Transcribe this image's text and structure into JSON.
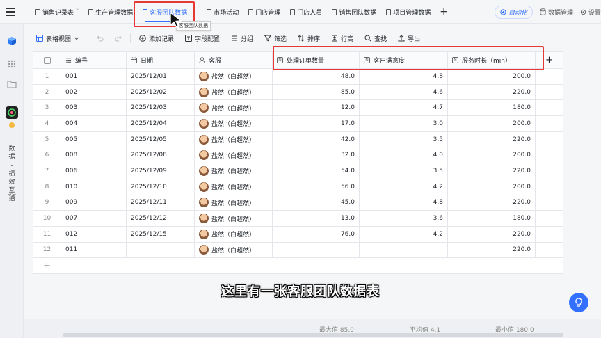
{
  "tabs": [
    {
      "label": "销售记录表",
      "suffix": "\""
    },
    {
      "label": "生产管理数据"
    },
    {
      "label": "客服团队数据",
      "active": true
    },
    {
      "label": "市场活动"
    },
    {
      "label": "门店管理"
    },
    {
      "label": "门店人员"
    },
    {
      "label": "销售团队数据"
    },
    {
      "label": "项目管理数据"
    }
  ],
  "tab_tooltip": "客服团队数据",
  "top_right": {
    "automation": "自动化",
    "data_manage": "数据管理",
    "settings": "设置"
  },
  "sidebar": {
    "workspace_label": [
      "数",
      "据",
      "-",
      "绩",
      "效",
      "互",
      "通"
    ]
  },
  "toolbar": {
    "view": "表格视图",
    "add_record": "添加记录",
    "field_config": "字段配置",
    "group": "分组",
    "filter": "筛选",
    "sort": "排序",
    "row_height": "行高",
    "find": "查找",
    "export": "导出"
  },
  "columns": {
    "code": "编号",
    "date": "日期",
    "agent": "客服",
    "orders": "处理订单数量",
    "satisfaction": "客户满意度",
    "duration": "服务时长（min）"
  },
  "rows": [
    {
      "idx": "1",
      "code": "001",
      "date": "2025/12/01",
      "agent": "盐然（白超然）",
      "orders": "48.0",
      "satisfaction": "4.8",
      "duration": "200.0"
    },
    {
      "idx": "2",
      "code": "002",
      "date": "2025/12/02",
      "agent": "盐然（白超然）",
      "orders": "85.0",
      "satisfaction": "4.6",
      "duration": "220.0"
    },
    {
      "idx": "3",
      "code": "003",
      "date": "2025/12/03",
      "agent": "盐然（白超然）",
      "orders": "12.0",
      "satisfaction": "4.7",
      "duration": "180.0"
    },
    {
      "idx": "4",
      "code": "004",
      "date": "2025/12/04",
      "agent": "盐然（白超然）",
      "orders": "17.0",
      "satisfaction": "3.0",
      "duration": "200.0"
    },
    {
      "idx": "5",
      "code": "005",
      "date": "2025/12/05",
      "agent": "盐然（白超然）",
      "orders": "42.0",
      "satisfaction": "3.5",
      "duration": "220.0"
    },
    {
      "idx": "6",
      "code": "008",
      "date": "2025/12/08",
      "agent": "盐然（白超然）",
      "orders": "32.0",
      "satisfaction": "4.0",
      "duration": "200.0"
    },
    {
      "idx": "7",
      "code": "006",
      "date": "2025/12/09",
      "agent": "盐然（白超然）",
      "orders": "54.0",
      "satisfaction": "3.5",
      "duration": "220.0"
    },
    {
      "idx": "8",
      "code": "010",
      "date": "2025/12/10",
      "agent": "盐然（白超然）",
      "orders": "56.0",
      "satisfaction": "4.2",
      "duration": "200.0"
    },
    {
      "idx": "9",
      "code": "009",
      "date": "2025/12/11",
      "agent": "盐然（白超然）",
      "orders": "45.0",
      "satisfaction": "4.8",
      "duration": "220.0"
    },
    {
      "idx": "10",
      "code": "007",
      "date": "2025/12/12",
      "agent": "盐然（白超然）",
      "orders": "13.0",
      "satisfaction": "3.6",
      "duration": "180.0"
    },
    {
      "idx": "11",
      "code": "012",
      "date": "2025/12/15",
      "agent": "盐然（白超然）",
      "orders": "76.0",
      "satisfaction": "4.2",
      "duration": "220.0"
    },
    {
      "idx": "12",
      "code": "011",
      "date": "",
      "agent": "盐然（白超然）",
      "orders": "",
      "satisfaction": "",
      "duration": "220.0"
    }
  ],
  "summary": {
    "max": "最大值 85.0",
    "avg": "平均值 4.1",
    "min": "最小值 180.0"
  },
  "subtitle": "这里有一张客服团队数据表",
  "colors": {
    "accent": "#3370ff",
    "highlight": "#e53935"
  }
}
